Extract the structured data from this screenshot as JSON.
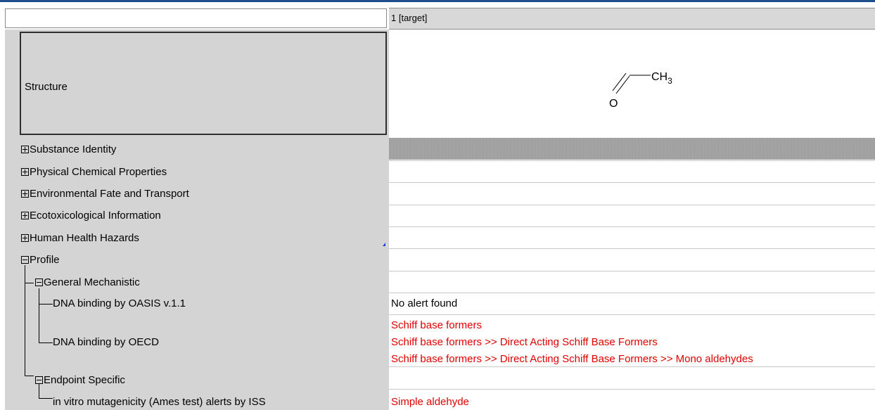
{
  "header": {
    "column_label": "1 [target]"
  },
  "structure": {
    "label": "Structure",
    "formula_o": "O",
    "formula_ch3": "CH",
    "formula_sub": "3"
  },
  "tree": {
    "substance_identity": "Substance Identity",
    "phys_chem": "Physical Chemical Properties",
    "env_fate": "Environmental Fate and Transport",
    "ecotox": "Ecotoxicological Information",
    "human_health": "Human Health Hazards",
    "profile": "Profile",
    "general_mechanistic": "General Mechanistic",
    "dna_oasis": "DNA binding by OASIS v.1.1",
    "dna_oecd": "DNA binding by OECD",
    "endpoint_specific": "Endpoint Specific",
    "ames_iss": "in vitro mutagenicity (Ames test) alerts by ISS"
  },
  "values": {
    "dna_oasis": "No alert found",
    "dna_oecd_1": "Schiff base formers",
    "dna_oecd_2": "Schiff base formers >> Direct Acting Schiff Base Formers",
    "dna_oecd_3": "Schiff base formers >> Direct Acting Schiff Base Formers >> Mono aldehydes",
    "ames_iss": "Simple aldehyde"
  },
  "colors": {
    "alert_red": "#e00000",
    "header_blue": "#1f4e8c",
    "panel_gray": "#d4d4d4"
  }
}
